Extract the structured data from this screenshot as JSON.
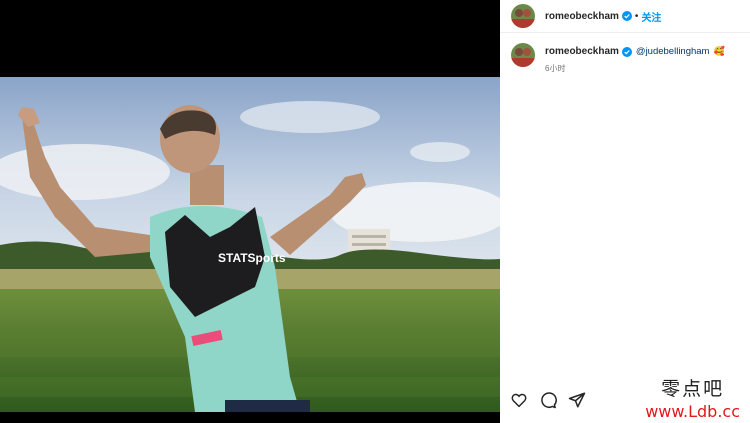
{
  "post": {
    "username": "romeobeckham",
    "follow_label": "关注",
    "separator": "•"
  },
  "caption": {
    "username": "romeobeckham",
    "mention": "@judebellingham",
    "emoji": "🥰",
    "time": "6小时"
  },
  "photo": {
    "vest_text": "STATSports"
  },
  "actions": {
    "icons": [
      "heart-icon",
      "comment-icon",
      "share-icon"
    ]
  },
  "watermark": {
    "line1": "零点吧",
    "line2": "www.Ldb.cc"
  },
  "colors": {
    "accent": "#0095f6",
    "verified": "#0095f6",
    "watermark_red": "#e21919"
  }
}
